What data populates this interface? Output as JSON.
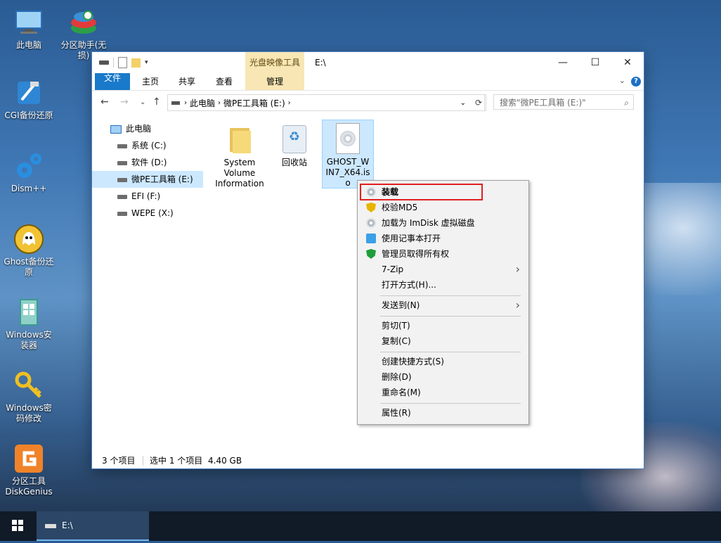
{
  "desktop": {
    "icons": [
      {
        "label": "此电脑"
      },
      {
        "label": "分区助手(无损)"
      },
      {
        "label": "CGI备份还原"
      },
      {
        "label": "Dism++"
      },
      {
        "label": "Ghost备份还原"
      },
      {
        "label": "Windows安装器"
      },
      {
        "label": "Windows密码修改"
      },
      {
        "label": "分区工具DiskGenius"
      }
    ]
  },
  "window": {
    "context_tab": "光盘映像工具",
    "title": "E:\\",
    "ribbon_tabs": [
      "文件",
      "主页",
      "共享",
      "查看",
      "管理"
    ],
    "address": {
      "crumbs": [
        "此电脑",
        "微PE工具箱 (E:)"
      ]
    },
    "search_placeholder": "搜索\"微PE工具箱 (E:)\"",
    "nav": {
      "root": "此电脑",
      "drives": [
        "系统 (C:)",
        "软件 (D:)",
        "微PE工具箱 (E:)",
        "EFI (F:)",
        "WEPE (X:)"
      ],
      "selected": "微PE工具箱 (E:)"
    },
    "files": [
      {
        "name": "System Volume Information",
        "type": "folder"
      },
      {
        "name": "回收站",
        "type": "recycle"
      },
      {
        "name": "GHOST_WIN7_X64.iso",
        "type": "iso",
        "selected": true
      }
    ],
    "status": {
      "count": "3 个项目",
      "selected": "选中 1 个项目",
      "size": "4.40 GB"
    }
  },
  "context_menu": {
    "items": [
      {
        "label": "装载",
        "icon": "disc-icon"
      },
      {
        "label": "校验MD5",
        "icon": "shield-icon"
      },
      {
        "label": "加载为 ImDisk 虚拟磁盘",
        "icon": "disc-icon"
      },
      {
        "label": "使用记事本打开",
        "icon": "notepad-icon"
      },
      {
        "label": "管理员取得所有权",
        "icon": "admin-shield-icon"
      },
      {
        "label": "7-Zip",
        "submenu": true
      },
      {
        "label": "打开方式(H)..."
      },
      {
        "label": "发送到(N)",
        "submenu": true
      },
      {
        "label": "剪切(T)"
      },
      {
        "label": "复制(C)"
      },
      {
        "label": "创建快捷方式(S)"
      },
      {
        "label": "删除(D)"
      },
      {
        "label": "重命名(M)"
      },
      {
        "label": "属性(R)"
      }
    ]
  },
  "taskbar": {
    "active_window": "E:\\"
  }
}
